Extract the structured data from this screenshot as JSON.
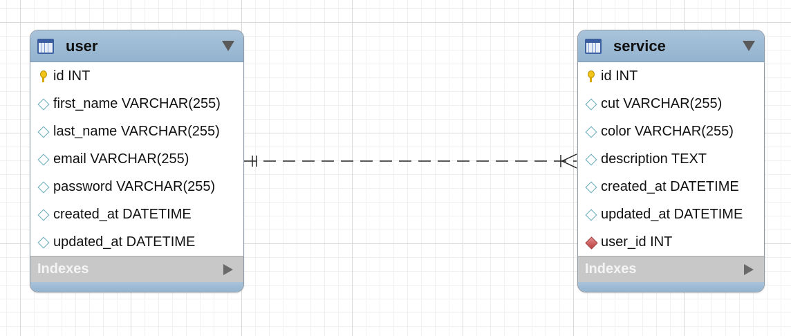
{
  "tables": {
    "user": {
      "name": "user",
      "columns": [
        {
          "text": "id INT",
          "kind": "primary-key"
        },
        {
          "text": "first_name VARCHAR(255)",
          "kind": "column"
        },
        {
          "text": "last_name VARCHAR(255)",
          "kind": "column"
        },
        {
          "text": "email VARCHAR(255)",
          "kind": "column"
        },
        {
          "text": "password VARCHAR(255)",
          "kind": "column"
        },
        {
          "text": "created_at DATETIME",
          "kind": "column"
        },
        {
          "text": "updated_at DATETIME",
          "kind": "column"
        }
      ],
      "indexes_label": "Indexes"
    },
    "service": {
      "name": "service",
      "columns": [
        {
          "text": "id INT",
          "kind": "primary-key"
        },
        {
          "text": "cut VARCHAR(255)",
          "kind": "column"
        },
        {
          "text": "color VARCHAR(255)",
          "kind": "column"
        },
        {
          "text": "description TEXT",
          "kind": "column"
        },
        {
          "text": "created_at DATETIME",
          "kind": "column"
        },
        {
          "text": "updated_at DATETIME",
          "kind": "column"
        },
        {
          "text": "user_id INT",
          "kind": "foreign-key"
        }
      ],
      "indexes_label": "Indexes"
    }
  },
  "relationship": {
    "from": "user",
    "to": "service",
    "from_cardinality": "one-and-only-one",
    "to_cardinality": "many",
    "style": "dashed"
  },
  "colors": {
    "header": "#9fbdd7",
    "indexes_bar": "#c8c8c8",
    "primary_key": "#f2c318",
    "foreign_key": "#c24a4a",
    "column_marker": "#5fa7b5"
  }
}
